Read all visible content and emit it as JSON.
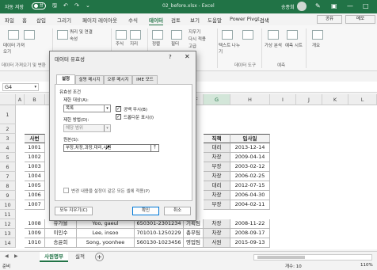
{
  "titlebar": {
    "autosave": "자동 저장",
    "autosave_state": "끔",
    "filename": "02_before.xlsx - Excel",
    "user": "송종희",
    "colors": {
      "brand": "#217346"
    }
  },
  "ribbon_tabs": [
    "파일",
    "홈",
    "삽입",
    "그리기",
    "페이지 레이아웃",
    "수식",
    "데이터",
    "검토",
    "보기",
    "도움말",
    "Power Pivot"
  ],
  "active_tab": "데이터",
  "search_label": "검색",
  "share_label": "공유",
  "memo_label": "메모",
  "ribbon": {
    "get_data": "데이터 가져오기 및 변환",
    "get_data_btn": "데이터 가져오기",
    "refresh": "모두 새로 고침",
    "query_items": [
      "쿼리 및 연결",
      "속성"
    ],
    "stocks": "주식",
    "geo": "지리",
    "sort": "정렬",
    "filter": "필터",
    "clear": "지우기",
    "reapply": "다시 적용",
    "advanced": "고급",
    "text_to_cols": "텍스트 나누기",
    "data_tools": "데이터 도구",
    "whatif": "가상 분석",
    "forecast_sheet": "예측 시트",
    "forecast": "예측",
    "outline": "개요"
  },
  "namebox": "G4",
  "columns": [
    "A",
    "B",
    "",
    "",
    "",
    "F",
    "G",
    "H",
    "I",
    "J",
    "K",
    "L"
  ],
  "rows": [
    "1",
    "2",
    "3",
    "4",
    "5",
    "6",
    "7",
    "8",
    "9",
    "10",
    "11",
    "12",
    "13"
  ],
  "table": {
    "headers": {
      "id": "사번",
      "position": "직책",
      "join_date": "입사일"
    },
    "rows": [
      {
        "id": "1001",
        "position": "대리",
        "date": "2013-12-14"
      },
      {
        "id": "1002",
        "position": "차장",
        "date": "2009-04-14"
      },
      {
        "id": "1003",
        "position": "부장",
        "date": "2003-02-12"
      },
      {
        "id": "1004",
        "position": "차장",
        "date": "2006-02-25"
      },
      {
        "id": "1005",
        "position": "대리",
        "date": "2012-07-15"
      },
      {
        "id": "1006",
        "position": "차장",
        "date": "2006-04-30"
      },
      {
        "id": "1007",
        "position": "부장",
        "date": "2004-02-11"
      },
      {
        "id": "1008",
        "name": "유가을",
        "eng": "Yoo, gaeul",
        "ssn": "650301-2301234",
        "dept": "기획팀",
        "position": "차장",
        "date": "2008-11-22"
      },
      {
        "id": "1009",
        "name": "이인수",
        "eng": "Lee, insoo",
        "ssn": "701010-1250229",
        "dept": "총무팀",
        "position": "차장",
        "date": "2008-09-17"
      },
      {
        "id": "1010",
        "name": "송윤희",
        "eng": "Song, yoonhee",
        "ssn": "560130-1023456",
        "dept": "영업팀",
        "position": "사원",
        "date": "2015-09-13"
      }
    ]
  },
  "sheets": [
    "사원명부",
    "실적"
  ],
  "active_sheet": "사원명부",
  "status": {
    "ready": "준비",
    "count": "개수: 10",
    "zoom": "110%"
  },
  "dialog": {
    "title": "데이터 유효성",
    "help": "?",
    "close": "✕",
    "tabs": [
      "설정",
      "설명 메시지",
      "오류 메시지",
      "IME 모드"
    ],
    "active_tab": "설정",
    "section": "유효성 조건",
    "allow_label": "제한 대상(A):",
    "allow_value": "목록",
    "ignore_blank": "공백 무시(B)",
    "dropdown": "드롭다운 표시(I)",
    "data_label": "제한 방법(D):",
    "data_value": "해당 범위",
    "source_label": "원본(S):",
    "source_value": "부장,차장,과장,대리,사원",
    "apply_all": "변경 내용을 설정이 같은 모든 셀에 적용(P)",
    "clear_all": "모두 지우기(C)",
    "ok": "확인",
    "cancel": "취소"
  }
}
